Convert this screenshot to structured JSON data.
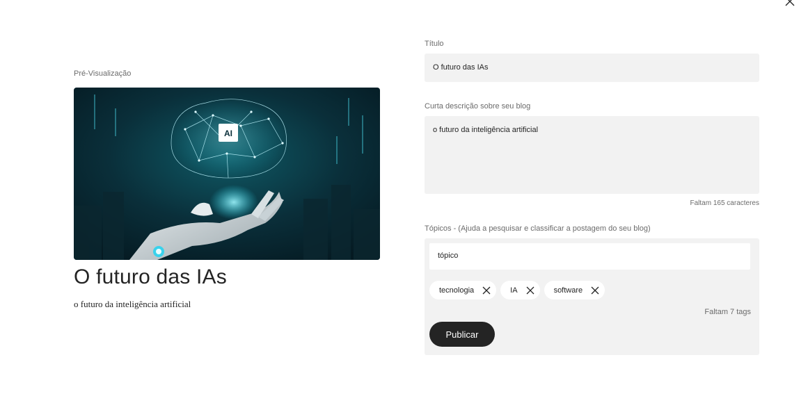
{
  "preview": {
    "label": "Pré-Visualização",
    "image_alt_icon": "ai-brain-robot-hand-image",
    "title": "O futuro das IAs",
    "description": "o futuro da inteligência artificial",
    "image_badge": "AI"
  },
  "form": {
    "title_label": "Título",
    "title_value": "O futuro das IAs",
    "description_label": "Curta descrição sobre seu blog",
    "description_value": "o futuro da inteligência artificial",
    "characters_left": "Faltam 165 caracteres",
    "topics_label": "Tópicos - (Ajuda a pesquisar e classificar a postagem do seu blog)",
    "topic_input_value": "tópico",
    "tags": [
      "tecnologia",
      "IA",
      "software"
    ],
    "tags_left": "Faltam 7 tags",
    "publish_label": "Publicar"
  },
  "colors": {
    "accent_dark": "#242424",
    "field_bg": "#f2f2f2",
    "muted_text": "#6b6b6b"
  }
}
